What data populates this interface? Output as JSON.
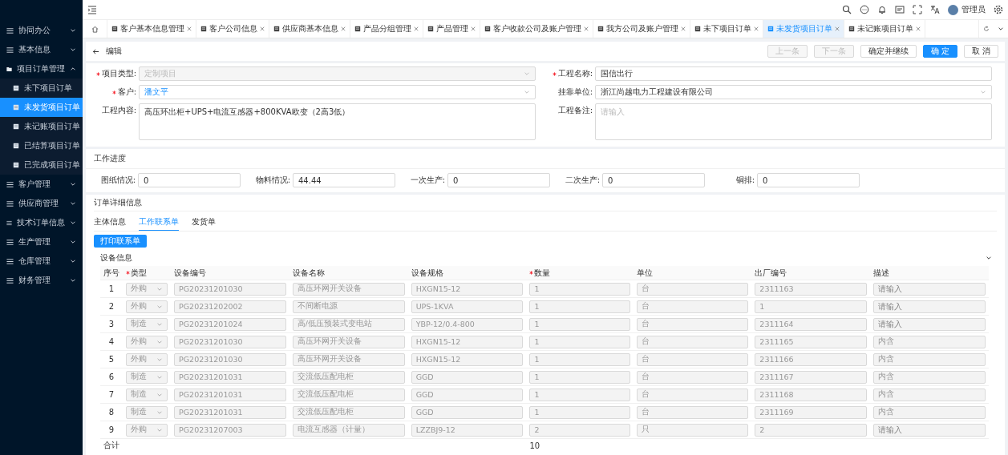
{
  "top_bar": {
    "user_name": "管理员"
  },
  "sidebar": {
    "items": [
      {
        "label": "协同办公",
        "expanded": false
      },
      {
        "label": "基本信息",
        "expanded": false
      },
      {
        "label": "项目订单管理",
        "expanded": true,
        "children": [
          {
            "label": "未下项目订单",
            "selected": false
          },
          {
            "label": "未发货项目订单",
            "selected": true
          },
          {
            "label": "未记账项目订单",
            "selected": false
          },
          {
            "label": "已结算项目订单",
            "selected": false
          },
          {
            "label": "已完成项目订单",
            "selected": false
          }
        ]
      },
      {
        "label": "客户管理",
        "expanded": false
      },
      {
        "label": "供应商管理",
        "expanded": false
      },
      {
        "label": "技术订单信息",
        "expanded": false
      },
      {
        "label": "生产管理",
        "expanded": false
      },
      {
        "label": "仓库管理",
        "expanded": false
      },
      {
        "label": "财务管理",
        "expanded": false
      }
    ]
  },
  "tabs": [
    {
      "label": "客户基本信息管理",
      "selected": false
    },
    {
      "label": "客户公司信息",
      "selected": false
    },
    {
      "label": "供应商基本信息",
      "selected": false
    },
    {
      "label": "产品分组管理",
      "selected": false
    },
    {
      "label": "产品管理",
      "selected": false
    },
    {
      "label": "客户收款公司及账户管理",
      "selected": false
    },
    {
      "label": "我方公司及账户管理",
      "selected": false
    },
    {
      "label": "未下项目订单",
      "selected": false
    },
    {
      "label": "未发货项目订单",
      "selected": true
    },
    {
      "label": "未记账项目订单",
      "selected": false
    }
  ],
  "page": {
    "title": "编辑",
    "buttons": [
      {
        "label": "上一条",
        "kind": "default",
        "disabled": true
      },
      {
        "label": "下一条",
        "kind": "default",
        "disabled": true
      },
      {
        "label": "确定并继续",
        "kind": "default",
        "disabled": false
      },
      {
        "label": "确 定",
        "kind": "primary",
        "disabled": false
      },
      {
        "label": "取 消",
        "kind": "default",
        "disabled": false
      }
    ]
  },
  "form": {
    "fields": [
      {
        "label": "项目类型:",
        "required": true,
        "kind": "select",
        "value": "定制项目",
        "disabled": true
      },
      {
        "label": "工程名称:",
        "required": true,
        "kind": "input",
        "value": "国信出行"
      },
      {
        "label": "客户:",
        "required": true,
        "kind": "select",
        "value": "潘文平",
        "highlighted": true
      },
      {
        "label": "挂靠单位:",
        "required": false,
        "kind": "select",
        "value": "浙江尚越电力工程建设有限公司"
      },
      {
        "label": "工程内容:",
        "required": false,
        "kind": "textarea",
        "value": "高压环出柜+UPS+电流互感器+800KVA欧变（2高3低）"
      },
      {
        "label": "工程备注:",
        "required": false,
        "kind": "textarea",
        "placeholder": "请输入"
      }
    ]
  },
  "progress": {
    "title": "工作进度",
    "fields": [
      {
        "label": "图纸情况:",
        "value": "0"
      },
      {
        "label": "物料情况:",
        "value": "44.44"
      },
      {
        "label": "一次生产:",
        "value": "0"
      },
      {
        "label": "二次生产:",
        "value": "0"
      },
      {
        "label": "铜排:",
        "value": "0"
      }
    ]
  },
  "details": {
    "title": "订单详细信息",
    "tabs": [
      {
        "label": "主体信息",
        "selected": false
      },
      {
        "label": "工作联系单",
        "selected": true
      },
      {
        "label": "发货单",
        "selected": false
      }
    ],
    "print_button": "打印联系单",
    "section": {
      "title": "设备信息",
      "expanded": true
    },
    "table": {
      "disabled": true,
      "columns": [
        {
          "label": "序号",
          "required": false
        },
        {
          "label": "类型",
          "required": true
        },
        {
          "label": "设备编号",
          "required": false
        },
        {
          "label": "设备名称",
          "required": false
        },
        {
          "label": "设备规格",
          "required": false
        },
        {
          "label": "数量",
          "required": true
        },
        {
          "label": "单位",
          "required": false
        },
        {
          "label": "出厂编号",
          "required": false
        },
        {
          "label": "描述",
          "required": false
        }
      ],
      "rows": [
        {
          "no": "1",
          "type": "外购",
          "code": "PG20231201030",
          "name": "高压环网开关设备",
          "spec": "HXGN15-12",
          "qty": "1",
          "unit": "台",
          "factory_no": "2311163",
          "description_placeholder": "请输入"
        },
        {
          "no": "2",
          "type": "外购",
          "code": "PG20231202002",
          "name": "不间断电源",
          "spec": "UPS-1KVA",
          "qty": "1",
          "unit": "台",
          "factory_no": "1",
          "description_placeholder": "请输入"
        },
        {
          "no": "3",
          "type": "制造",
          "code": "PG20231201024",
          "name": "高/低压预装式变电站",
          "spec": "YBP-12/0.4-800",
          "qty": "1",
          "unit": "台",
          "factory_no": "2311164",
          "description_placeholder": "请输入"
        },
        {
          "no": "4",
          "type": "外购",
          "code": "PG20231201030",
          "name": "高压环网开关设备",
          "spec": "HXGN15-12",
          "qty": "1",
          "unit": "台",
          "factory_no": "2311165",
          "description": "内含"
        },
        {
          "no": "5",
          "type": "外购",
          "code": "PG20231201030",
          "name": "高压环网开关设备",
          "spec": "HXGN15-12",
          "qty": "1",
          "unit": "台",
          "factory_no": "2311166",
          "description": "内含"
        },
        {
          "no": "6",
          "type": "制造",
          "code": "PG20231201031",
          "name": "交流低压配电柜",
          "spec": "GGD",
          "qty": "1",
          "unit": "台",
          "factory_no": "2311167",
          "description": "内含"
        },
        {
          "no": "7",
          "type": "制造",
          "code": "PG20231201031",
          "name": "交流低压配电柜",
          "spec": "GGD",
          "qty": "1",
          "unit": "台",
          "factory_no": "2311168",
          "description": "内含"
        },
        {
          "no": "8",
          "type": "制造",
          "code": "PG20231201031",
          "name": "交流低压配电柜",
          "spec": "GGD",
          "qty": "1",
          "unit": "台",
          "factory_no": "2311169",
          "description": "内含"
        },
        {
          "no": "9",
          "type": "外购",
          "code": "PG20231207003",
          "name": "电流互感器（计量）",
          "spec": "LZZBJ9-12",
          "qty": "2",
          "unit": "只",
          "factory_no": "2",
          "description_placeholder": "请输入"
        }
      ],
      "total": {
        "label": "合计",
        "qty": "10"
      }
    }
  }
}
